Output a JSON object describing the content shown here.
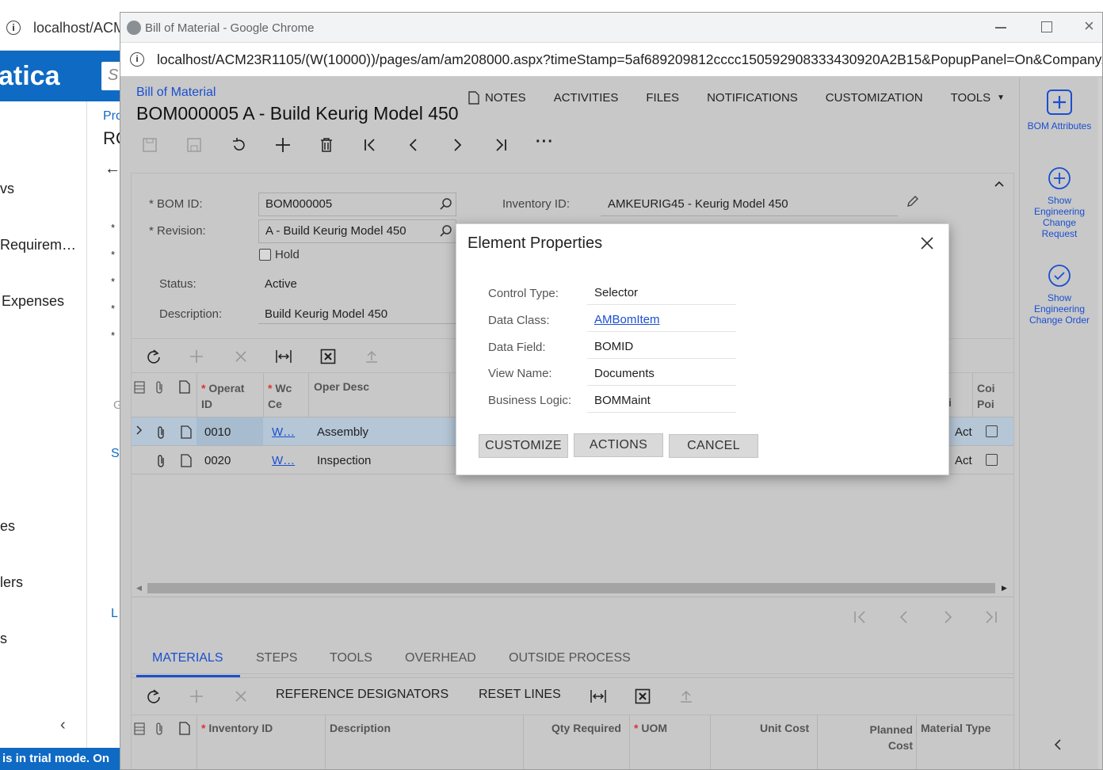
{
  "background": {
    "url_fragment": "localhost/ACM",
    "logo_text": "atica",
    "search_fragment": "S",
    "nav_items": [
      "vs",
      "Requirem…",
      "Expenses",
      "es",
      "lers",
      "s"
    ],
    "breadcrumb_fragment": "Pro",
    "title_fragment": "RC",
    "side_letters": [
      "*",
      "*",
      "*",
      "*",
      "*",
      "G",
      "S",
      "L"
    ],
    "trial_banner": "is in trial mode. On"
  },
  "window": {
    "title": "Bill of Material - Google Chrome",
    "url": "localhost/ACM23R1105/(W(10000))/pages/am/am208000.aspx?timeStamp=5af689209812cccc150592908333430920A2B15&PopupPanel=On&Company..."
  },
  "page": {
    "breadcrumb": "Bill of Material",
    "title": "BOM000005 A - Build Keurig Model 450",
    "top_menu": [
      "NOTES",
      "ACTIVITIES",
      "FILES",
      "NOTIFICATIONS",
      "CUSTOMIZATION",
      "TOOLS"
    ]
  },
  "form": {
    "bom_id_label": "BOM ID:",
    "bom_id_value": "BOM000005",
    "revision_label": "Revision:",
    "revision_value": "A - Build Keurig Model 450",
    "hold_label": "Hold",
    "status_label": "Status:",
    "status_value": "Active",
    "description_label": "Description:",
    "description_value": "Build Keurig Model 450",
    "inventory_label": "Inventory ID:",
    "inventory_value": "AMKEURIG45 - Keurig Model 450"
  },
  "ops_grid": {
    "headers": {
      "operation": "Operat ID",
      "wc": "Wc Ce",
      "desc": "Oper Desc",
      "right1": "i",
      "right2": "Coi Poi"
    },
    "rows": [
      {
        "op": "0010",
        "wc": "W…",
        "desc": "Assembly",
        "right": "Act"
      },
      {
        "op": "0020",
        "wc": "W…",
        "desc": "Inspection",
        "right": "Act"
      }
    ]
  },
  "tabs": {
    "items": [
      "MATERIALS",
      "STEPS",
      "TOOLS",
      "OVERHEAD",
      "OUTSIDE PROCESS"
    ],
    "active": "MATERIALS"
  },
  "materials_toolbar": {
    "reference_designators": "REFERENCE DESIGNATORS",
    "reset_lines": "RESET LINES"
  },
  "materials_grid": {
    "headers": [
      "Inventory ID",
      "Description",
      "Qty Required",
      "UOM",
      "Unit Cost",
      "Planned Cost",
      "Material Type"
    ]
  },
  "right_panel": [
    "BOM Attributes",
    "Show Engineering Change Request",
    "Show Engineering Change Order"
  ],
  "dialog": {
    "title": "Element Properties",
    "props": [
      {
        "label": "Control Type:",
        "value": "Selector"
      },
      {
        "label": "Data Class:",
        "value": "AMBomItem"
      },
      {
        "label": "Data Field:",
        "value": "BOMID"
      },
      {
        "label": "View Name:",
        "value": "Documents"
      },
      {
        "label": "Business Logic:",
        "value": "BOMMaint"
      }
    ],
    "buttons": {
      "customize": "CUSTOMIZE",
      "actions": "ACTIONS",
      "cancel": "CANCEL"
    }
  },
  "colors": {
    "accent": "#0f6ac4",
    "link": "#1a4fd0",
    "overlay": "#c8c8c8",
    "selected_row": "#b5c6d6"
  }
}
